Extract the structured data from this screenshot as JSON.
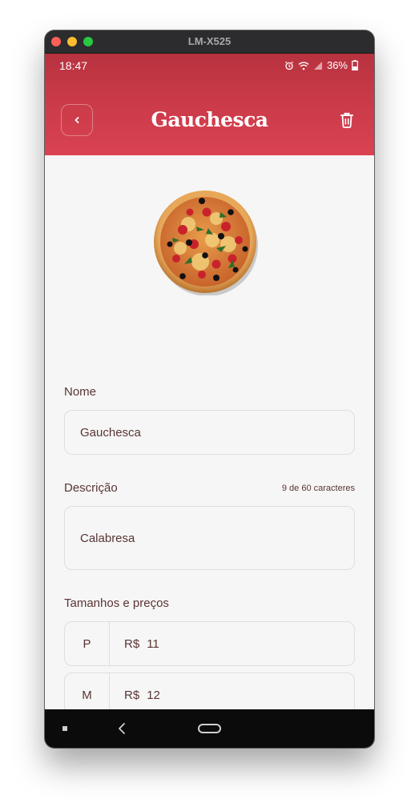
{
  "window": {
    "title": "LM-X525"
  },
  "status_bar": {
    "time": "18:47",
    "battery": "36%",
    "icons": [
      "alarm-icon",
      "wifi-icon",
      "signal-icon",
      "battery-icon"
    ]
  },
  "app_bar": {
    "title": "Gauchesca",
    "back_icon": "chevron-left-icon",
    "delete_icon": "trash-icon"
  },
  "form": {
    "name_label": "Nome",
    "name_value": "Gauchesca",
    "description_label": "Descrição",
    "description_counter": "9 de 60 caracteres",
    "description_value": "Calabresa",
    "sizes_label": "Tamanhos e preços",
    "sizes": [
      {
        "size": "P",
        "currency": "R$",
        "price": "11"
      },
      {
        "size": "M",
        "currency": "R$",
        "price": "12"
      },
      {
        "size": "",
        "currency": "",
        "price": ""
      }
    ]
  },
  "colors": {
    "brand": "#d43f4f",
    "text": "#5a3434",
    "background": "#f6f6f6"
  }
}
